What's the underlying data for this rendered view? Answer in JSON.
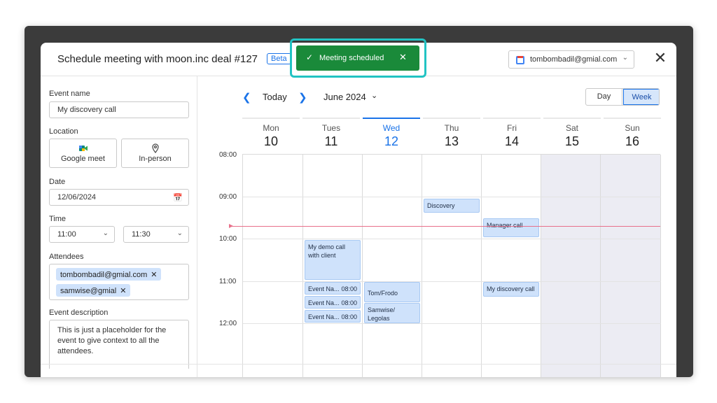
{
  "dialog": {
    "title": "Schedule meeting with moon.inc deal #127",
    "beta": "Beta",
    "account": "tombombadil@gmial.com",
    "account_icon": "google-calendar-icon",
    "close_icon": "close-icon"
  },
  "toast": {
    "message": "Meeting scheduled",
    "background": "#1a8a3a",
    "highlight": "#22c3c3"
  },
  "form": {
    "event_name_label": "Event name",
    "event_name_value": "My discovery call",
    "location_label": "Location",
    "location_options": [
      "Google meet",
      "In-person"
    ],
    "date_label": "Date",
    "date_value": "12/06/2024",
    "time_label": "Time",
    "time_start": "11:00",
    "time_end": "11:30",
    "attendees_label": "Attendees",
    "attendees": [
      "tombombadil@gmial.com",
      "samwise@gmial"
    ],
    "description_label": "Event description",
    "description_value": "This is just a placeholder for the event to give context to all the attendees."
  },
  "calendar": {
    "today_label": "Today",
    "month_label": "June 2024",
    "view_day": "Day",
    "view_week": "Week",
    "active_view": "Week",
    "days": [
      {
        "name": "Mon",
        "num": "10"
      },
      {
        "name": "Tues",
        "num": "11"
      },
      {
        "name": "Wed",
        "num": "12"
      },
      {
        "name": "Thu",
        "num": "13"
      },
      {
        "name": "Fri",
        "num": "14"
      },
      {
        "name": "Sat",
        "num": "15"
      },
      {
        "name": "Sun",
        "num": "16"
      }
    ],
    "selected_day": "Wed 12",
    "times": [
      "08:00",
      "09:00",
      "10:00",
      "11:00",
      "12:00"
    ],
    "events": {
      "discovery": "Discovery",
      "manager_call": "Manager call",
      "demo_call": "My demo call with client",
      "event_a_title": "Event Na...",
      "event_a_time": "08:00",
      "event_b_title": "Event Na...",
      "event_b_time": "08:00",
      "event_c_title": "Event Na...",
      "event_c_time": "08:00",
      "tom_frodo": "Tom/Frodo",
      "samwise_legolas": "Samwise/ Legolas",
      "my_discovery_call": "My discovery call"
    },
    "accent": "#1a73e8",
    "event_color": "#cfe2fb",
    "now_line_color": "#e8708a"
  }
}
